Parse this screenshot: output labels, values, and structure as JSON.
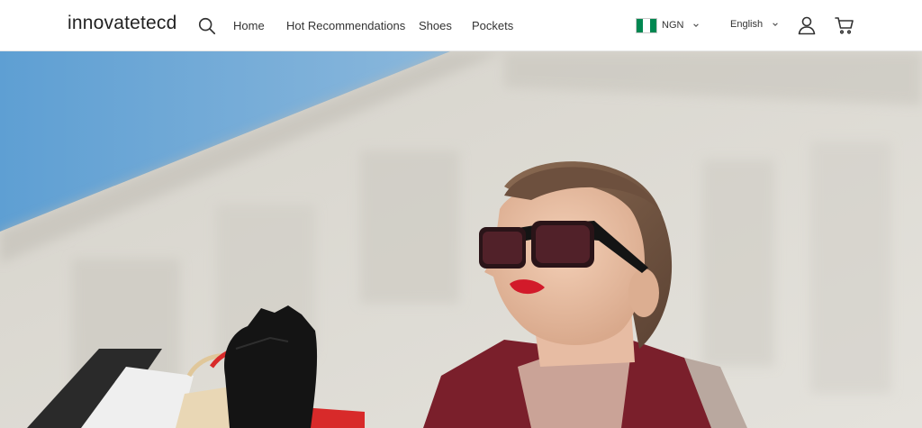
{
  "header": {
    "logo": "innovatetecd",
    "search_icon": "search-icon",
    "nav": [
      {
        "label": "Home"
      },
      {
        "label": "Hot Recommendations"
      },
      {
        "label": "Shoes"
      },
      {
        "label": "Pockets"
      }
    ],
    "currency": {
      "code": "NGN",
      "flag_colors": [
        "#008751",
        "#ffffff",
        "#008751"
      ]
    },
    "language": {
      "label": "English"
    },
    "account_icon": "user-icon",
    "cart_icon": "cart-icon"
  },
  "hero": {
    "image": "hero-photo",
    "colors": {
      "sky": "#6aa6d6",
      "wall": "#dcdad3",
      "lips": "#d21a2a",
      "coat": "#7a1f2b"
    }
  }
}
